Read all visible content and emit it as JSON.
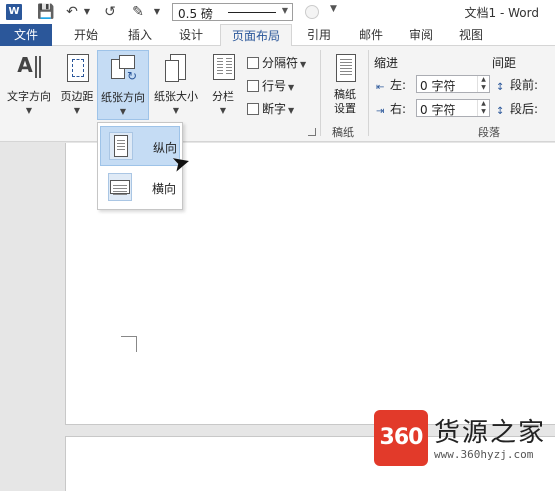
{
  "title_bar": {
    "word_icon_letter": "W",
    "line_weight_value": "0.5 磅",
    "document_title": "文档1 - Word"
  },
  "tabs": [
    {
      "label": "文件"
    },
    {
      "label": "开始"
    },
    {
      "label": "插入"
    },
    {
      "label": "设计"
    },
    {
      "label": "页面布局"
    },
    {
      "label": "引用"
    },
    {
      "label": "邮件"
    },
    {
      "label": "审阅"
    },
    {
      "label": "视图"
    }
  ],
  "ribbon": {
    "text_direction": "文字方向",
    "margins": "页边距",
    "orientation": "纸张方向",
    "size": "纸张大小",
    "columns": "分栏",
    "breaks": "分隔符",
    "line_numbers": "行号",
    "hyphenation": "断字",
    "manuscript_line1": "稿纸",
    "manuscript_line2": "设置",
    "manuscript_group": "稿纸",
    "indent_header": "缩进",
    "spacing_header": "间距",
    "indent_left_label": "左:",
    "indent_left_value": "0 字符",
    "indent_right_label": "右:",
    "indent_right_value": "0 字符",
    "spacing_before_label": "段前:",
    "spacing_after_label": "段后:",
    "paragraph_group": "段落"
  },
  "orientation_menu": {
    "items": [
      {
        "label": "纵向",
        "selected": true
      },
      {
        "label": "横向",
        "selected": false
      }
    ]
  },
  "watermark": {
    "badge": "360",
    "text": "货源之家",
    "url": "www.360hyzj.com"
  },
  "colors": {
    "accent": "#2b579a",
    "highlight": "#c5dcf4",
    "watermark_red": "#e23a2a"
  }
}
